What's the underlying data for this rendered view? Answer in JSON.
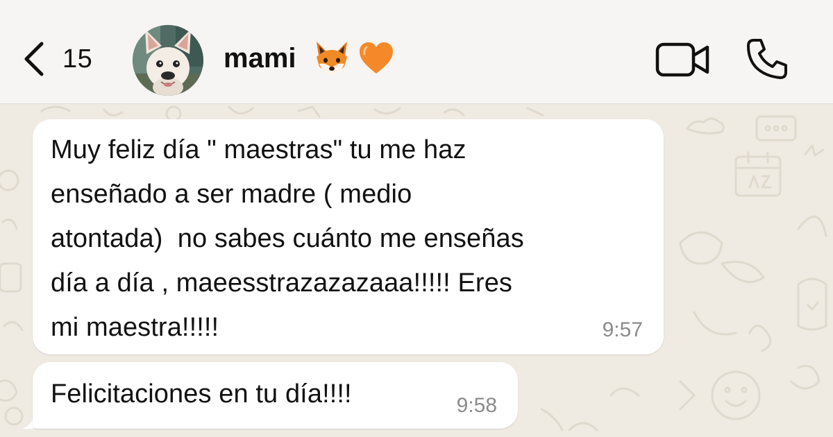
{
  "header": {
    "back_count": "15",
    "contact_name": "mami",
    "name_emojis": [
      "fox-face",
      "orange-heart"
    ]
  },
  "messages": [
    {
      "text": "Muy feliz día \" maestras\" tu me haz\nenseñado a ser madre ( medio\natontada)  no sabes cuánto me enseñas\ndía a día , maeesstrazazazaaa!!!!! Eres\nmi maestra!!!!!",
      "time": "9:57"
    },
    {
      "text": "Felicitaciones en tu día!!!!",
      "time": "9:58"
    }
  ],
  "colors": {
    "header_bg": "#f6f5f3",
    "chat_bg": "#efeae2",
    "bubble_bg": "#ffffff",
    "timestamp": "#8b8b8b",
    "heart": "#f5892a"
  }
}
